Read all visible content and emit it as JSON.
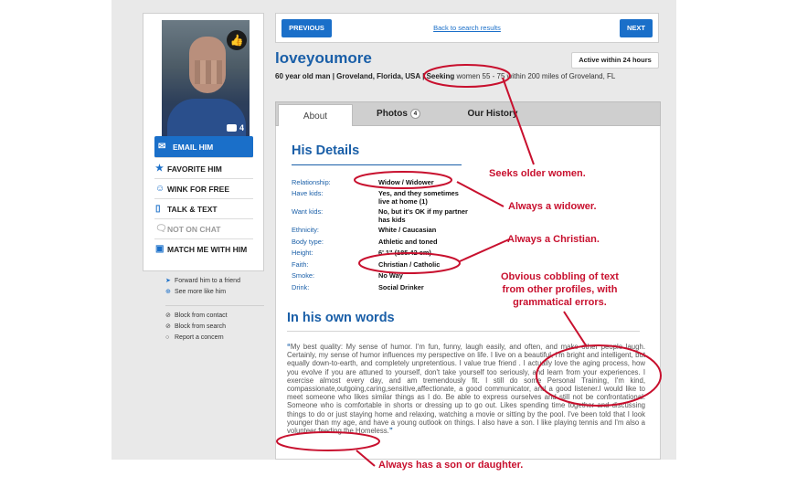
{
  "nav": {
    "previous_label": "PREVIOUS",
    "back_label": "Back to search results",
    "next_label": "NEXT"
  },
  "profile": {
    "username": "loveyoumore",
    "active_badge": "Active within 24 hours",
    "age_line": "60 year old man | Groveland, Florida, USA |",
    "seeking_label": "Seeking",
    "seeking_text": "women 55 - 75 within 200 miles of Groveland, FL",
    "photo_count": "4"
  },
  "actions": {
    "email": "EMAIL HIM",
    "favorite": "FAVORITE HIM",
    "wink": "WINK FOR FREE",
    "talk": "TALK & TEXT",
    "not_on_chat": "NOT ON CHAT",
    "match": "MATCH ME WITH HIM"
  },
  "links": {
    "forward": "Forward him to a friend",
    "see_more": "See more like him",
    "block_contact": "Block from contact",
    "block_search": "Block from search",
    "report": "Report a concern"
  },
  "tabs": {
    "about": "About",
    "photos": "Photos",
    "photos_count": "4",
    "history": "Our History"
  },
  "details": {
    "heading": "His Details",
    "rows": [
      {
        "k": "Relationship:",
        "v": "Widow / Widower"
      },
      {
        "k": "Have kids:",
        "v": "Yes, and they sometimes live at home (1)"
      },
      {
        "k": "Want kids:",
        "v": "No, but it's OK if my partner has kids"
      },
      {
        "k": "Ethnicity:",
        "v": "White / Caucasian"
      },
      {
        "k": "Body type:",
        "v": "Athletic and toned"
      },
      {
        "k": "Height:",
        "v": "6' 1\" (185.42 cm)"
      },
      {
        "k": "Faith:",
        "v": "Christian / Catholic"
      },
      {
        "k": "Smoke:",
        "v": "No Way"
      },
      {
        "k": "Drink:",
        "v": "Social Drinker"
      }
    ]
  },
  "words": {
    "heading": "In his own words",
    "text": "My best quality: My sense of humor. I'm fun, funny, laugh easily, and often, and make other people laugh. Certainly, my sense of humor influences my perspective on life. I live on a beautiful, I'm bright and intelligent, but equally down-to-earth, and completely unpretentious. I value true friend . I actually love the aging process, how you evolve if you are attuned to yourself, don't take yourself too seriously, and learn from your experiences. I exercise almost every day, and am tremendously fit. I still do some Personal Training,  I'm kind, compassionate,outgoing,caring,sensitive,affectionate, a good communicator, and a good listener.I would like to meet someone who likes similar things as I do. Be able to express ourselves and still not be confrontational. Someone who is comfortable in shorts or dressing up to go out. Likes spending time together and discussing things to do or just staying home and relaxing, watching a movie or sitting by the pool. I've been told that I look younger than my age, and have a young outlook on things. I also have a son. I like playing tennis and I'm also a volunteer feeding the Homeless."
  },
  "annotations": {
    "older": "Seeks older women.",
    "widower": "Always a widower.",
    "christian": "Always a Christian.",
    "cobbling": "Obvious cobbling of text from other profiles, with grammatical errors.",
    "cobbling_l1": "Obvious cobbling of text",
    "cobbling_l2": "from other profiles, with",
    "cobbling_l3": "grammatical errors.",
    "son": "Always has a son or daughter."
  },
  "colors": {
    "brand_blue": "#1a6fc9",
    "heading_blue": "#1a5fa8",
    "annotation_red": "#c8102e"
  },
  "icons": [
    "thumbs-up-icon",
    "camera-icon",
    "envelope-icon",
    "star-icon",
    "smiley-icon",
    "phone-icon",
    "chat-bubble-icon",
    "match-icon",
    "arrow-icon",
    "circle-plus-icon",
    "block-icon",
    "circle-icon"
  ]
}
